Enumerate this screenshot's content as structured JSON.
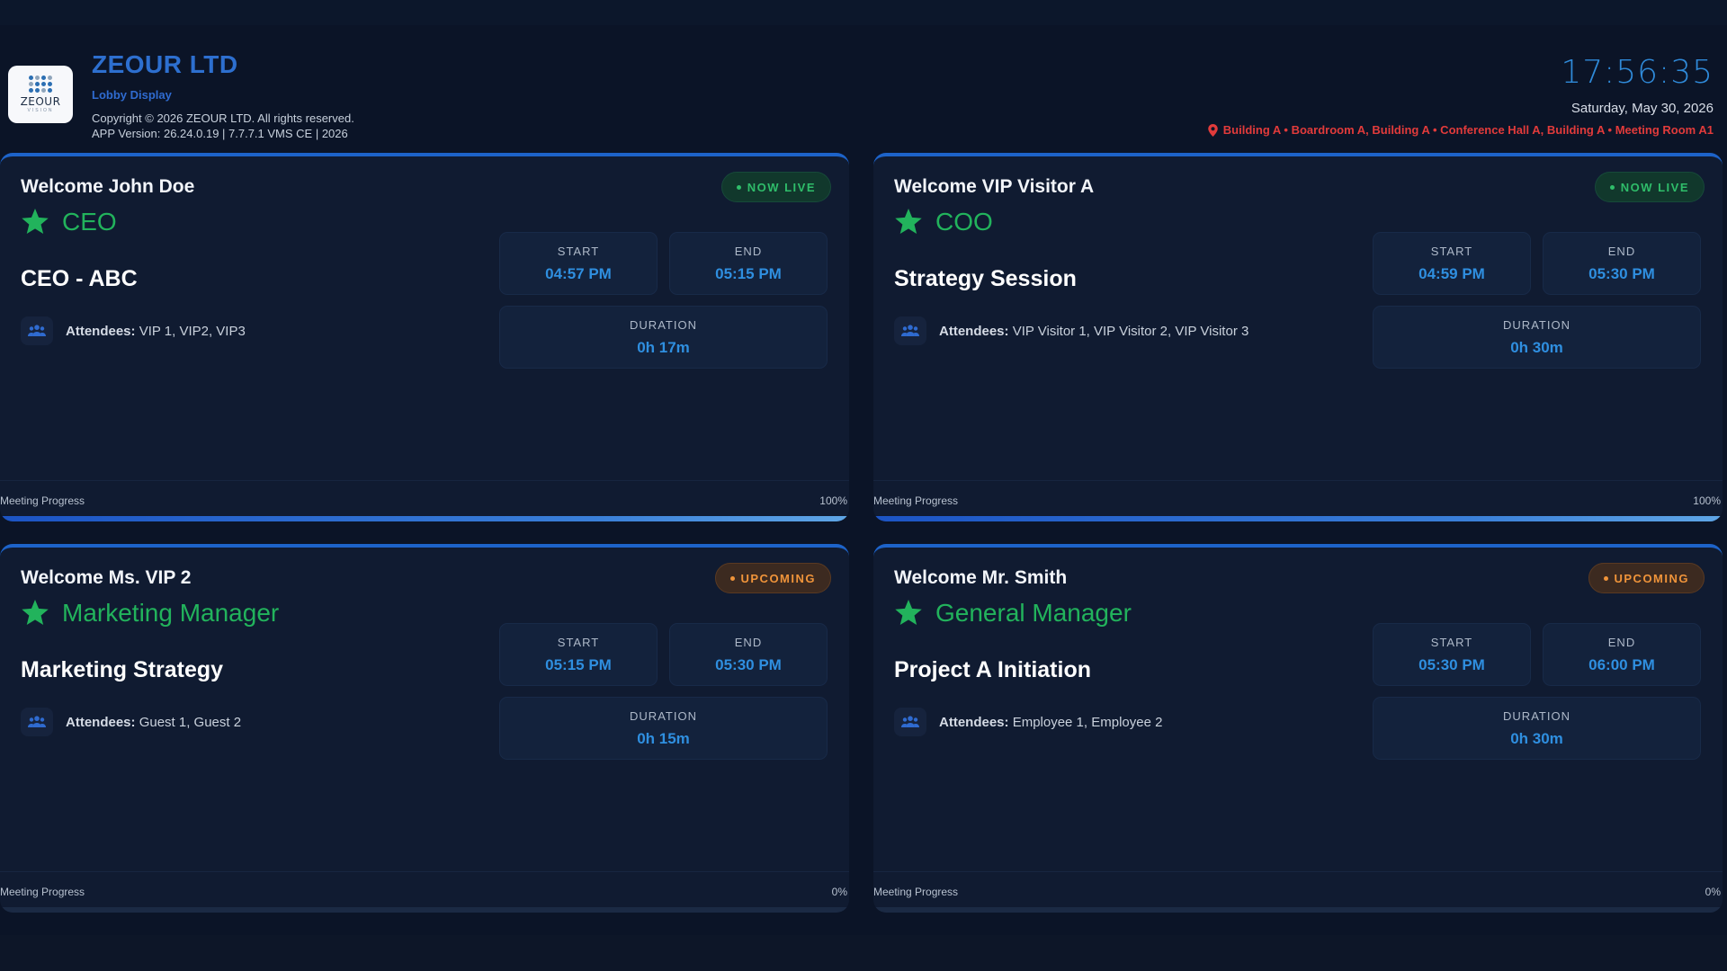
{
  "header": {
    "company": "ZEOUR LTD",
    "subtitle": "Lobby Display",
    "copyright": "Copyright © 2026 ZEOUR LTD. All rights reserved.",
    "version": "APP Version: 26.24.0.19 | 7.7.7.1 VMS CE | 2026",
    "logo_text": "ZEOUR",
    "logo_subtext": "VISION",
    "clock": "17:56:35",
    "date": "Saturday, May 30, 2026",
    "locations": "Building A • Boardroom A, Building A • Conference Hall A, Building A • Meeting Room A1",
    "location_icon": "map-pin-icon",
    "accent_color": "#2d6fcf",
    "location_color": "#e23b3b"
  },
  "labels": {
    "start": "START",
    "end": "END",
    "duration": "DURATION",
    "attendees": "Attendees:",
    "progress": "Meeting Progress"
  },
  "cards": [
    {
      "welcome": "Welcome John Doe",
      "role": "CEO",
      "title": "CEO - ABC",
      "status": "NOW LIVE",
      "status_type": "live",
      "start": "04:57 PM",
      "end": "05:15 PM",
      "duration": "0h 17m",
      "attendees": "VIP 1, VIP2, VIP3",
      "progress": 100,
      "progress_label": "100%"
    },
    {
      "welcome": "Welcome VIP Visitor A",
      "role": "COO",
      "title": "Strategy Session",
      "status": "NOW LIVE",
      "status_type": "live",
      "start": "04:59 PM",
      "end": "05:30 PM",
      "duration": "0h 30m",
      "attendees": "VIP Visitor 1, VIP Visitor 2, VIP Visitor 3",
      "progress": 100,
      "progress_label": "100%"
    },
    {
      "welcome": "Welcome Ms. VIP 2",
      "role": "Marketing Manager",
      "title": "Marketing Strategy",
      "status": "UPCOMING",
      "status_type": "upcoming",
      "start": "05:15 PM",
      "end": "05:30 PM",
      "duration": "0h 15m",
      "attendees": "Guest 1, Guest 2",
      "progress": 0,
      "progress_label": "0%"
    },
    {
      "welcome": "Welcome Mr. Smith",
      "role": "General Manager",
      "title": "Project A Initiation",
      "status": "UPCOMING",
      "status_type": "upcoming",
      "start": "05:30 PM",
      "end": "06:00 PM",
      "duration": "0h 30m",
      "attendees": "Employee 1, Employee 2",
      "progress": 0,
      "progress_label": "0%"
    }
  ],
  "colors": {
    "live": "#2fbd6a",
    "upcoming": "#f0943a",
    "role": "#22b35c",
    "time": "#2f8fe0"
  },
  "icons": {
    "role": "star-icon",
    "attendees": "users-icon"
  }
}
